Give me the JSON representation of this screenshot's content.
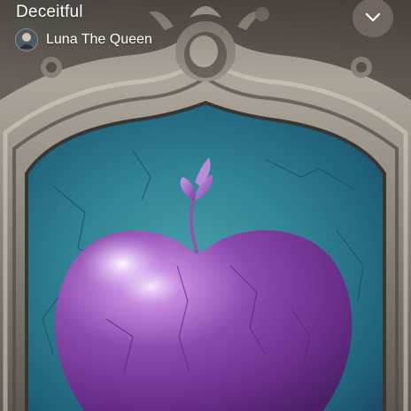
{
  "track": {
    "title": "Deceitful",
    "artist": "Luna The Queen"
  },
  "artwork": {
    "subject": "purple apple in ornate mirror",
    "colors": {
      "frame": "#8f887f",
      "mirror_teal": "#2d8a98",
      "apple": "#7c3f9a"
    }
  },
  "controls": {
    "collapse_icon": "chevron-down-icon"
  }
}
